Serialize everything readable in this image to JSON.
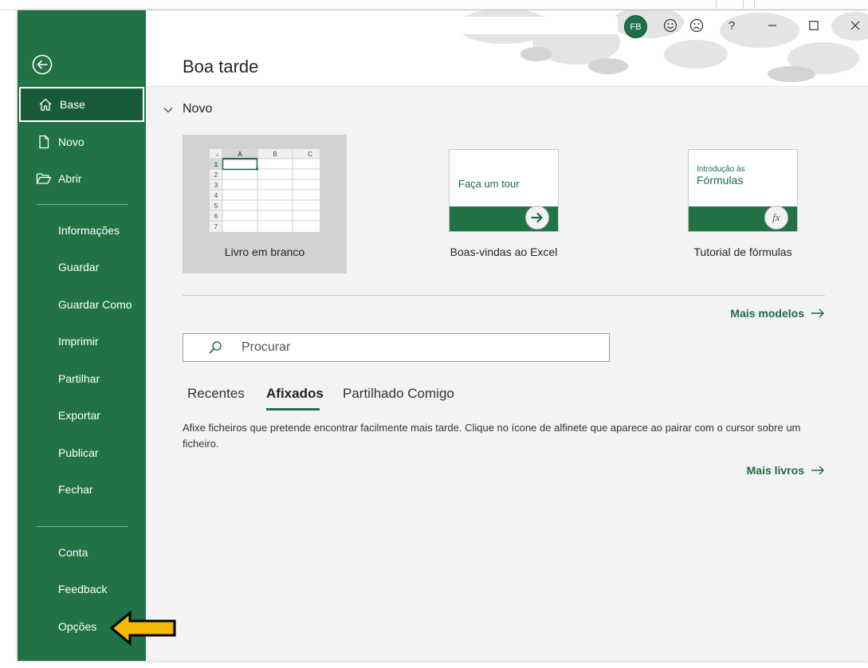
{
  "colors": {
    "sidebar": "#217346",
    "sidebar_active": "#185c37",
    "accent": "#1e6b43",
    "callout_arrow": "#f5b800"
  },
  "sidebar": {
    "back_icon": "back-arrow-circle-icon",
    "top_items": [
      {
        "label": "Base",
        "icon": "home-icon"
      },
      {
        "label": "Novo",
        "icon": "new-document-icon"
      },
      {
        "label": "Abrir",
        "icon": "folder-open-icon"
      }
    ],
    "middle_items": [
      "Informações",
      "Guardar",
      "Guardar Como",
      "Imprimir",
      "Partilhar",
      "Exportar",
      "Publicar",
      "Fechar"
    ],
    "bottom_items": [
      "Conta",
      "Feedback",
      "Opções"
    ]
  },
  "header": {
    "greeting": "Boa tarde",
    "avatar_initials": "FB",
    "help": "?"
  },
  "new_section": {
    "title": "Novo",
    "templates": [
      {
        "caption": "Livro em branco"
      },
      {
        "caption": "Boas-vindas ao Excel",
        "thumb_text": "Faça um tour"
      },
      {
        "caption": "Tutorial de fórmulas",
        "thumb_small": "Introdução às",
        "thumb_big": "Fórmulas",
        "fx": "fx"
      }
    ],
    "grid_cols": [
      "A",
      "B",
      "C"
    ],
    "grid_rows": [
      "1",
      "2",
      "3",
      "4",
      "5",
      "6",
      "7"
    ],
    "more_templates": "Mais modelos"
  },
  "search": {
    "placeholder": "Procurar"
  },
  "tabs": [
    "Recentes",
    "Afixados",
    "Partilhado Comigo"
  ],
  "pinned_info": "Afixe ficheiros que pretende encontrar facilmente mais tarde. Clique no ícone de alfinete que aparece ao pairar com o cursor sobre um ficheiro.",
  "more_books": "Mais livros"
}
